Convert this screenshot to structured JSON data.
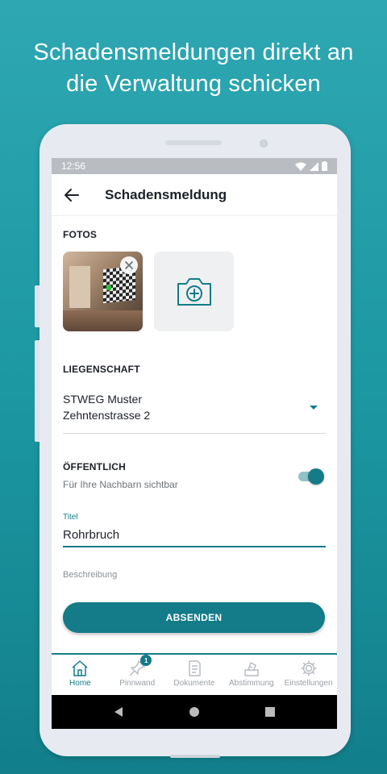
{
  "headline": {
    "line1": "Schadensmeldungen direkt an",
    "line2": "die Verwaltung schicken"
  },
  "statusbar": {
    "time": "12:56",
    "icons": [
      "wifi-icon",
      "signal-icon",
      "battery-icon"
    ]
  },
  "appbar": {
    "back_icon": "arrow-left-icon",
    "title": "Schadensmeldung"
  },
  "photos": {
    "label": "FOTOS",
    "remove_icon": "close-icon",
    "add_icon": "camera-add-icon"
  },
  "property": {
    "label": "LIEGENSCHAFT",
    "value_line1": "STWEG Muster",
    "value_line2": "Zehntenstrasse 2"
  },
  "public": {
    "label": "ÖFFENTLICH",
    "sublabel": "Für Ihre Nachbarn sichtbar",
    "enabled": true
  },
  "title_field": {
    "label": "Titel",
    "value": "Rohrbruch"
  },
  "description_field": {
    "placeholder": "Beschreibung"
  },
  "submit": {
    "label": "ABSENDEN"
  },
  "tabs": [
    {
      "label": "Home",
      "icon": "home-icon",
      "active": true
    },
    {
      "label": "Pinnwand",
      "icon": "pin-icon",
      "badge": "1"
    },
    {
      "label": "Dokumente",
      "icon": "document-icon"
    },
    {
      "label": "Abstimmung",
      "icon": "vote-icon"
    },
    {
      "label": "Einstellungen",
      "icon": "gear-icon"
    }
  ],
  "colors": {
    "accent": "#147b88",
    "background": "#1c98a3"
  }
}
